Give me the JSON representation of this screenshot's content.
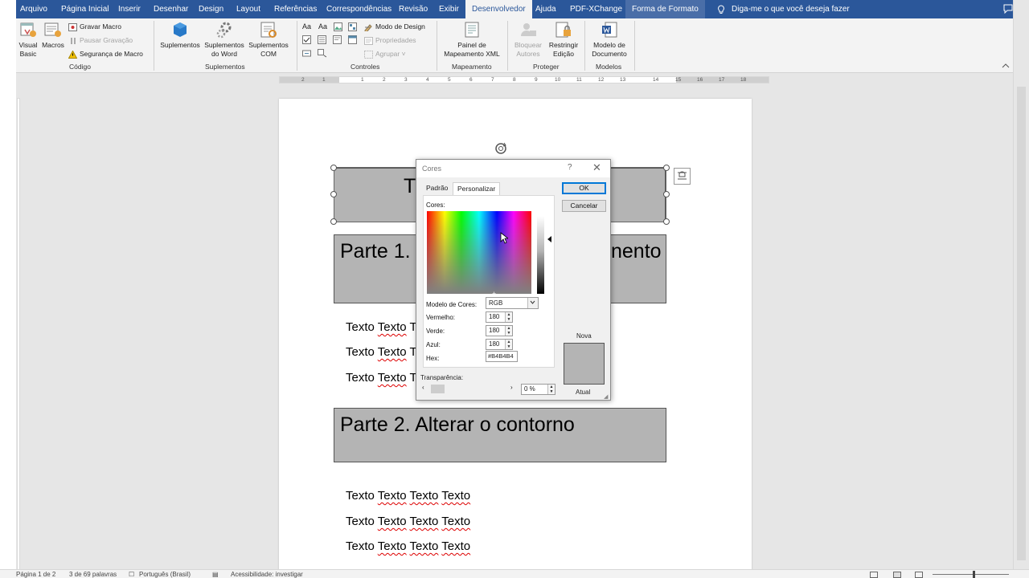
{
  "tabs": [
    {
      "label": "Arquivo"
    },
    {
      "label": "Página Inicial"
    },
    {
      "label": "Inserir"
    },
    {
      "label": "Desenhar"
    },
    {
      "label": "Design"
    },
    {
      "label": "Layout"
    },
    {
      "label": "Referências"
    },
    {
      "label": "Correspondências"
    },
    {
      "label": "Revisão"
    },
    {
      "label": "Exibir"
    },
    {
      "label": "Desenvolvedor"
    },
    {
      "label": "Ajuda"
    },
    {
      "label": "PDF-XChange"
    },
    {
      "label": "Forma de Formato"
    }
  ],
  "active_tab": "Desenvolvedor",
  "tell_me": "Diga-me o que você deseja fazer",
  "ribbon": {
    "codigo": {
      "label": "Código",
      "visual_basic": "Visual Basic",
      "macros": "Macros",
      "gravar": "Gravar Macro",
      "pausar": "Pausar Gravação",
      "seguranca": "Segurança de Macro"
    },
    "suplementos": {
      "label": "Suplementos",
      "suplementos": "Suplementos",
      "suplementos_word_1": "Suplementos",
      "suplementos_word_2": "do Word",
      "suplementos_com_1": "Suplementos",
      "suplementos_com_2": "COM"
    },
    "controles": {
      "label": "Controles",
      "modo_design": "Modo de Design",
      "propriedades": "Propriedades",
      "agrupar": "Agrupar",
      "aa_label": "Aa"
    },
    "mapeamento": {
      "label": "Mapeamento",
      "painel_1": "Painel de",
      "painel_2": "Mapeamento XML"
    },
    "proteger": {
      "label": "Proteger",
      "bloquear_1": "Bloquear",
      "bloquear_2": "Autores",
      "restringir_1": "Restringir",
      "restringir_2": "Edição"
    },
    "modelos": {
      "label": "Modelos",
      "modelo_1": "Modelo de",
      "modelo_2": "Documento"
    }
  },
  "ruler_ticks": [
    "2",
    "1",
    "1",
    "2",
    "3",
    "4",
    "5",
    "6",
    "7",
    "8",
    "9",
    "10",
    "11",
    "12",
    "13",
    "14",
    "15",
    "16",
    "17",
    "18"
  ],
  "document": {
    "title_shape_text": "T",
    "part1_title": "Parte 1.",
    "part1_title_tail": "nento",
    "part2_title": "Parte 2. Alterar o contorno",
    "lines_part1": [
      {
        "w1": "Texto",
        "w2": "Texto",
        "w3": "T"
      },
      {
        "w1": "Texto",
        "w2": "Texto",
        "w3": "T"
      },
      {
        "w1": "Texto",
        "w2": "Texto",
        "w3": "T"
      }
    ],
    "lines_part2": [
      {
        "w1": "Texto",
        "w2": "Texto",
        "w3": "Texto",
        "w4": "Texto"
      },
      {
        "w1": "Texto",
        "w2": "Texto",
        "w3": "Texto",
        "w4": "Texto"
      },
      {
        "w1": "Texto",
        "w2": "Texto",
        "w3": "Texto",
        "w4": "Texto"
      }
    ],
    "fill_color": "#B4B4B4"
  },
  "dialog": {
    "title": "Cores",
    "help": "?",
    "close": "✕",
    "tab_padrao": "Padrão",
    "tab_personalizar": "Personalizar",
    "active_tab": "Personalizar",
    "colors_label": "Cores:",
    "model_label": "Modelo de Cores:",
    "model_value": "RGB",
    "red_label": "Vermelho:",
    "red_value": "180",
    "green_label": "Verde:",
    "green_value": "180",
    "blue_label": "Azul:",
    "blue_value": "180",
    "hex_label": "Hex:",
    "hex_value": "#B4B4B4",
    "transparency_label": "Transparência:",
    "transparency_value": "0 %",
    "ok": "OK",
    "cancel": "Cancelar",
    "new_label": "Nova",
    "current_label": "Atual",
    "new_color": "#B4B4B4"
  },
  "status": {
    "page": "Página 1 de 2",
    "words": "3 de 69 palavras",
    "language": "Português (Brasil)",
    "accessibility": "Acessibilidade: investigar"
  },
  "colors": {
    "accent": "#2B579A",
    "ribbon_bg": "#F3F3F3",
    "canvas_bg": "#E6E6E6"
  }
}
